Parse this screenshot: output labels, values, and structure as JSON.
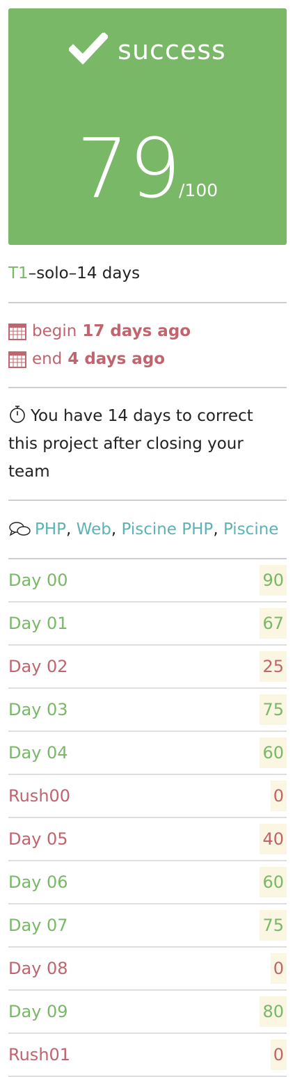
{
  "result": {
    "status": "success",
    "score": "79",
    "max": "/100"
  },
  "meta": {
    "type_code": "T1",
    "separator": " – ",
    "mode": "solo",
    "duration": "14 days"
  },
  "dates": {
    "begin_label": "begin",
    "begin_value": "17 days ago",
    "end_label": "end",
    "end_value": "4 days ago"
  },
  "correction_note": "You have 14 days to correct this project after closing your team",
  "tags": [
    "PHP",
    "Web",
    "Piscine PHP",
    "Piscine"
  ],
  "projects": [
    {
      "name": "Day 00",
      "mark": "90",
      "state": "ok"
    },
    {
      "name": "Day 01",
      "mark": "67",
      "state": "ok"
    },
    {
      "name": "Day 02",
      "mark": "25",
      "state": "ko"
    },
    {
      "name": "Day 03",
      "mark": "75",
      "state": "ok"
    },
    {
      "name": "Day 04",
      "mark": "60",
      "state": "ok"
    },
    {
      "name": "Rush00",
      "mark": "0",
      "state": "ko"
    },
    {
      "name": "Day 05",
      "mark": "40",
      "state": "ko"
    },
    {
      "name": "Day 06",
      "mark": "60",
      "state": "ok"
    },
    {
      "name": "Day 07",
      "mark": "75",
      "state": "ok"
    },
    {
      "name": "Day 08",
      "mark": "0",
      "state": "ko"
    },
    {
      "name": "Day 09",
      "mark": "80",
      "state": "ok"
    },
    {
      "name": "Rush01",
      "mark": "0",
      "state": "ko"
    }
  ],
  "colors": {
    "success": "#78b867",
    "fail": "#c0646e",
    "link": "#5bb3b6",
    "mark_bg": "#faf6e1"
  },
  "icons": [
    "check-icon",
    "calendar-icon",
    "stopwatch-icon",
    "chat-icon"
  ]
}
